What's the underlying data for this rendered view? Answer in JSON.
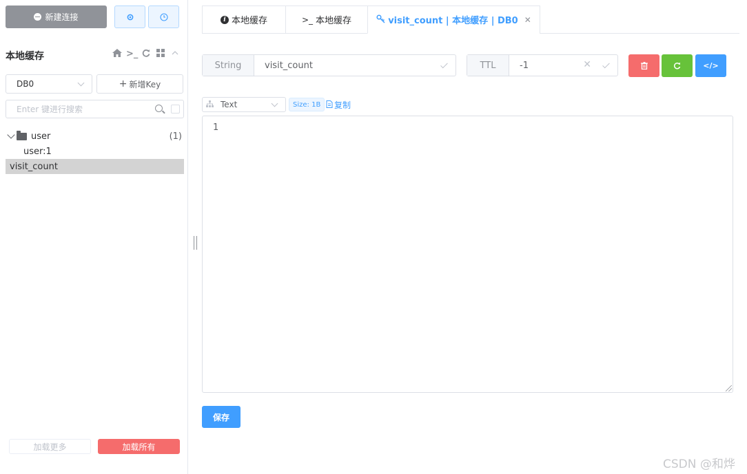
{
  "sidebar": {
    "new_connection_label": "新建连接",
    "settings_icon": "gear-icon",
    "history_icon": "clock-icon",
    "connection_name": "本地缓存",
    "db_select_value": "DB0",
    "add_key_label": "新增Key",
    "search_placeholder": "Enter 键进行搜索",
    "tree": {
      "folder_name": "user",
      "folder_count": "(1)",
      "folder_child": "user:1",
      "root_key": "visit_count"
    },
    "load_more_label": "加载更多",
    "load_all_label": "加载所有"
  },
  "tabs": [
    {
      "label": "本地缓存"
    },
    {
      "label": "本地缓存"
    },
    {
      "label": "visit_count | 本地缓存 | DB0"
    }
  ],
  "detail": {
    "type_label": "String",
    "key_name": "visit_count",
    "ttl_label": "TTL",
    "ttl_value": "-1",
    "format_value": "Text",
    "size_label": "Size: 1B",
    "copy_label": "复制",
    "content": "1",
    "save_label": "保存"
  },
  "colors": {
    "primary": "#409eff",
    "danger": "#f56c6c",
    "success": "#67c23a",
    "neutral": "#909399"
  },
  "watermark": "CSDN @和烨"
}
